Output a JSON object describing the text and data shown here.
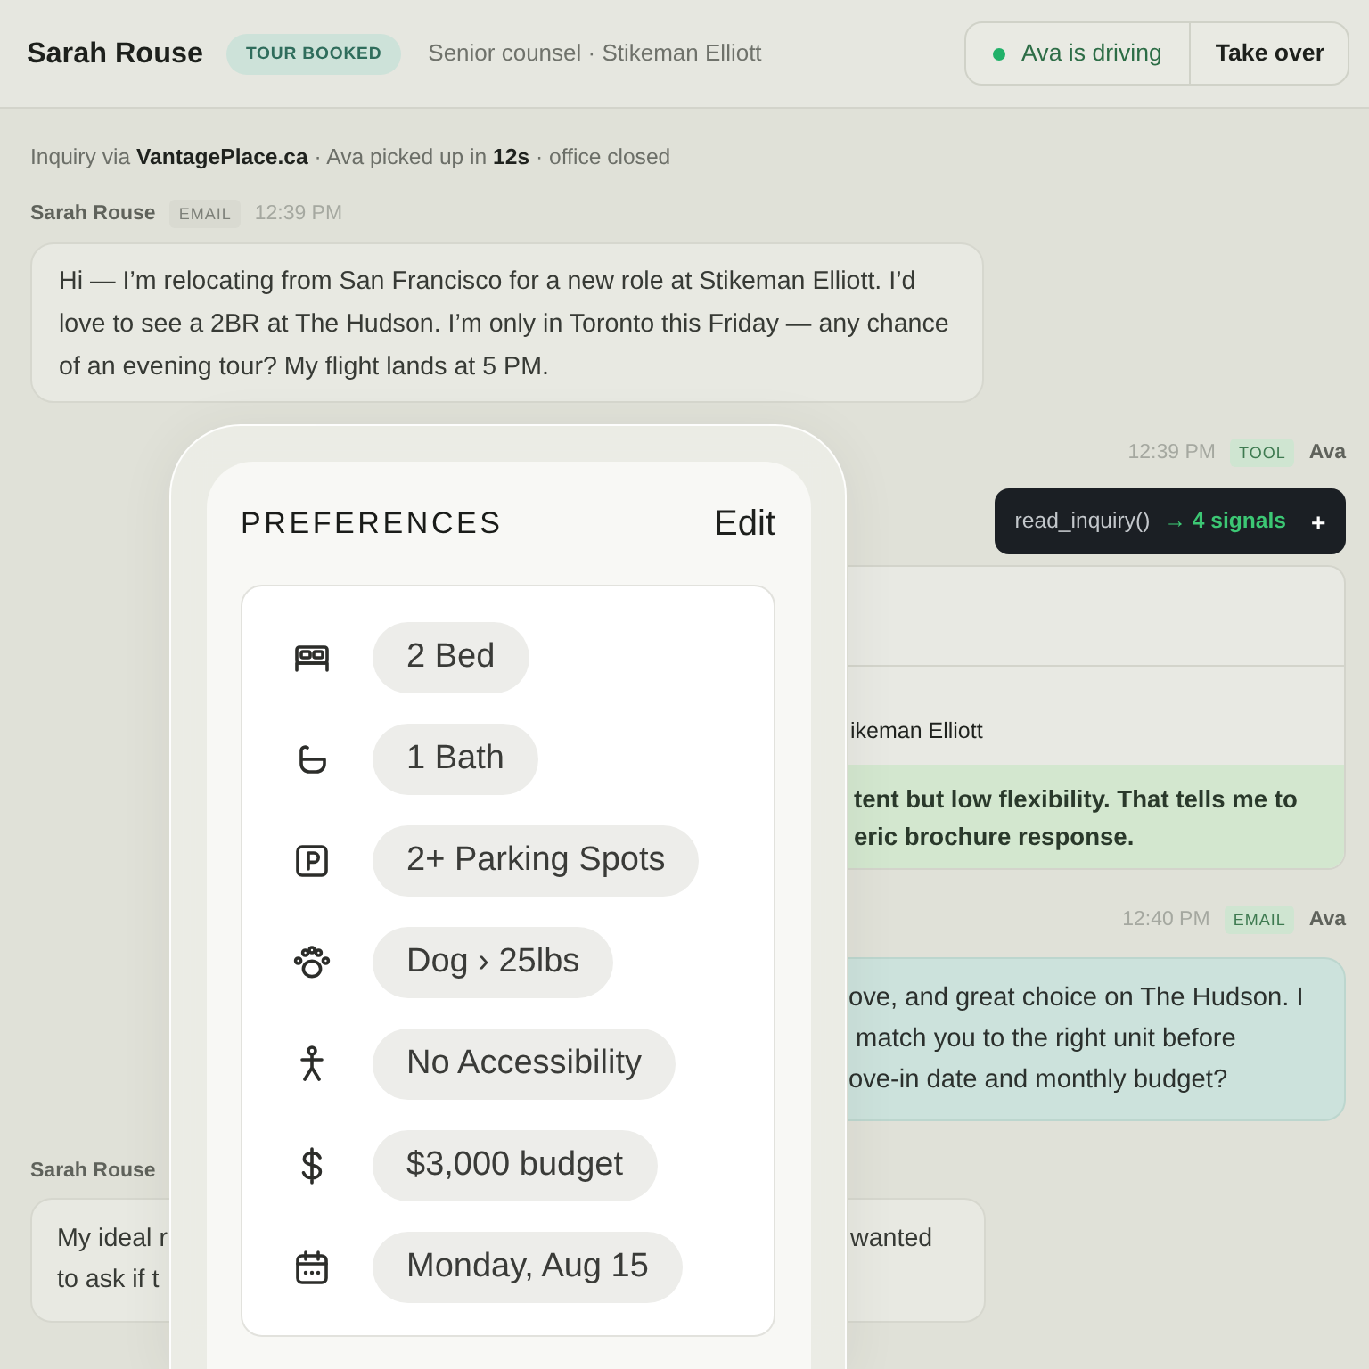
{
  "header": {
    "contact_name": "Sarah Rouse",
    "status_badge": "TOUR BOOKED",
    "subtitle": "Senior counsel · Stikeman Elliott",
    "driver_status": "Ava is driving",
    "take_over_button": "Take over"
  },
  "inquiry_note": "Inquiry via **VantagePlace.ca** · Ava picked up in **12s** · office closed",
  "messages": [
    {
      "outgoing": false,
      "sender": "Sarah Rouse",
      "channel": "EMAIL",
      "time": "12:39 PM",
      "text": "Hi — I’m relocating from San Francisco for a new role at Stikeman Elliott. I’d love to see a 2BR at The Hudson. I’m only in Toronto this Friday — any chance of an evening tour? My flight lands at 5 PM."
    },
    {
      "outgoing": true,
      "sender": "Ava",
      "channel": "TOOL",
      "time": "12:39 PM",
      "tool_call": {
        "function": "read_inquiry()",
        "result": "→ 4 signals",
        "expand": "+"
      },
      "result_card": {
        "text": "ikeman Elliott",
        "insight_lines": [
          "tent but low flexibility. That tells me to",
          "eric brochure response."
        ]
      }
    },
    {
      "outgoing": true,
      "sender": "Ava",
      "channel": "EMAIL",
      "time": "12:40 PM",
      "visible_lines": [
        "ove, and great choice on The Hudson. I",
        " match you to the right unit before",
        "ove-in date and monthly budget?"
      ]
    },
    {
      "outgoing": false,
      "sender": "Sarah Rouse",
      "visible_lines_left": [
        "My ideal r",
        "to ask if t"
      ],
      "visible_lines_right": [
        "wanted"
      ]
    }
  ],
  "preferences": {
    "title": "PREFERENCES",
    "edit": "Edit",
    "items": [
      {
        "kind": "bed",
        "label": "2 Bed"
      },
      {
        "kind": "bath",
        "label": "1 Bath"
      },
      {
        "kind": "parking",
        "label": "2+ Parking Spots"
      },
      {
        "kind": "pet",
        "label": "Dog › 25lbs"
      },
      {
        "kind": "accessibility",
        "label": "No Accessibility"
      },
      {
        "kind": "budget",
        "label": "$3,000 budget"
      },
      {
        "kind": "date",
        "label": "Monday, Aug 15"
      }
    ]
  }
}
